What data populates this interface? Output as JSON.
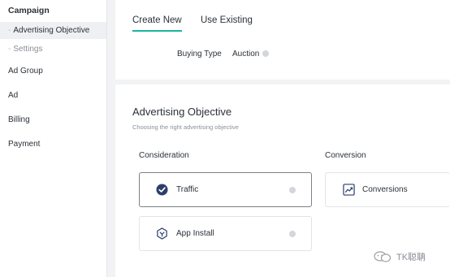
{
  "sidebar": {
    "group_title": "Campaign",
    "sub_items": [
      {
        "label": "Advertising Objective",
        "active": true
      },
      {
        "label": "Settings",
        "active": false
      }
    ],
    "items": [
      "Ad Group",
      "Ad",
      "Billing",
      "Payment"
    ]
  },
  "tabs": {
    "create_new": "Create New",
    "use_existing": "Use Existing",
    "accent_color": "#1bb3a1"
  },
  "buying_type": {
    "label": "Buying Type",
    "value": "Auction"
  },
  "objective": {
    "title": "Advertising Objective",
    "subtitle": "Choosing the right advertising objective",
    "consideration_label": "Consideration",
    "conversion_label": "Conversion",
    "options": {
      "traffic": {
        "label": "Traffic",
        "icon": "check-circle-icon",
        "selected": true
      },
      "app_install": {
        "label": "App Install",
        "icon": "hexagon-arrow-icon",
        "selected": false
      },
      "conversions": {
        "label": "Conversions",
        "icon": "trend-chart-icon",
        "selected": false
      }
    }
  },
  "watermark": {
    "text": "TK聪聃"
  }
}
